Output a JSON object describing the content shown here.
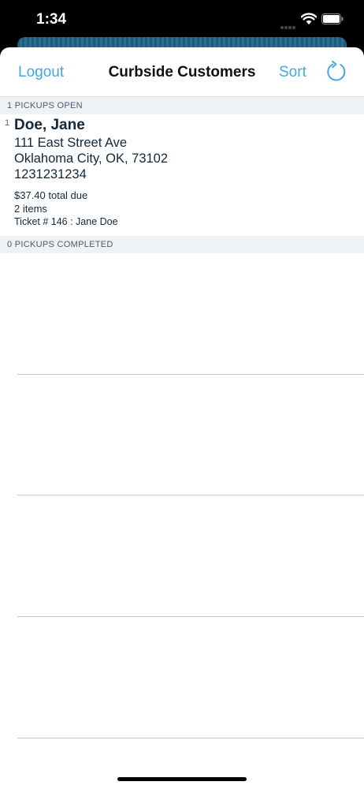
{
  "status_bar": {
    "time": "1:34"
  },
  "nav": {
    "logout_label": "Logout",
    "title": "Curbside Customers",
    "sort_label": "Sort",
    "accent_color": "#47a6df"
  },
  "open_section": {
    "header": "1 PICKUPS OPEN",
    "orders": [
      {
        "index": "1",
        "name": "Doe, Jane",
        "street": "111 East Street Ave",
        "city_state_zip": "Oklahoma City, OK, 73102",
        "phone": "1231231234",
        "total_due": "$37.40 total due",
        "item_count": "2 items",
        "ticket": "Ticket # 146 : Jane Doe"
      }
    ]
  },
  "completed_section": {
    "header": "0 PICKUPS COMPLETED"
  }
}
